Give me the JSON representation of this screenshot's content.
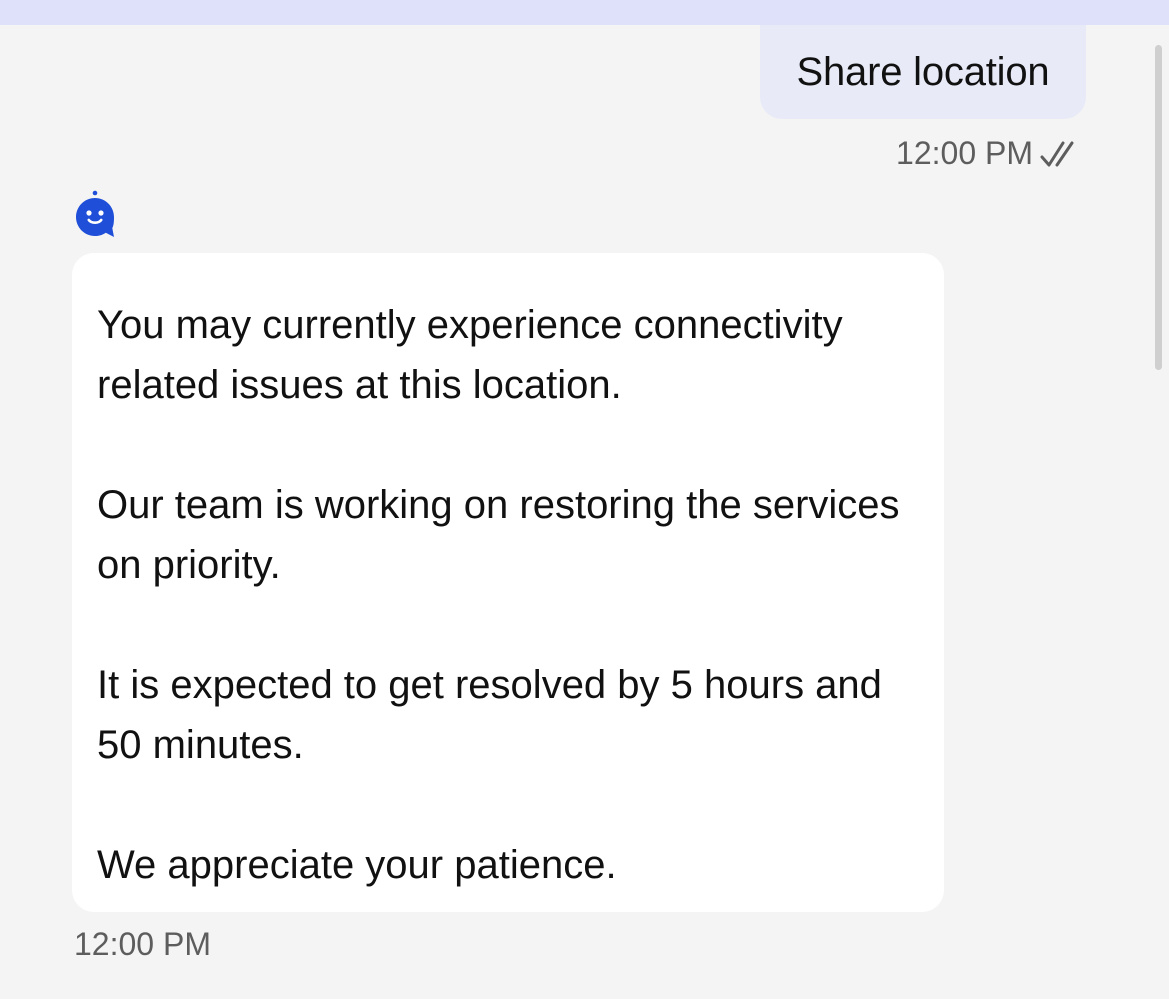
{
  "conversation": {
    "user_message": {
      "text": "Share location",
      "timestamp": "12:00 PM",
      "status_icon": "double-check-icon"
    },
    "bot_message": {
      "avatar_icon": "chat-bot-icon",
      "paragraphs": [
        "You may currently experience connectivity related issues at this location.",
        "Our team is working on restoring the services on priority.",
        "It is expected to get resolved by 5 hours and 50 minutes.",
        "We appreciate your patience."
      ],
      "timestamp": "12:00 PM"
    }
  },
  "colors": {
    "background": "#f4f4f4",
    "top_strip": "#dfe1fb",
    "user_bubble": "#e8ebf7",
    "bot_bubble": "#ffffff",
    "accent_blue": "#1f4fd8",
    "timestamp_gray": "#5d5d5d"
  }
}
